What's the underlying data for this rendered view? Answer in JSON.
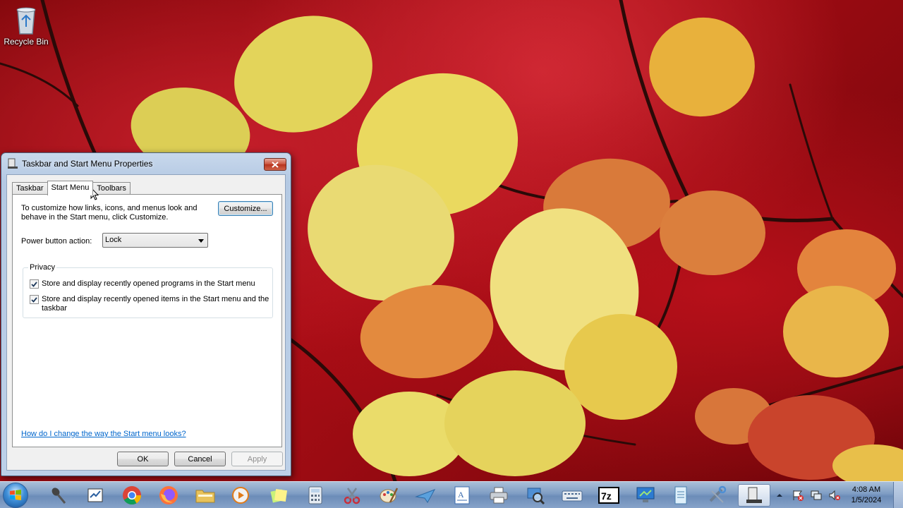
{
  "desktop": {
    "icons": [
      {
        "label": "Recycle Bin",
        "icon": "recycle-bin-icon"
      }
    ]
  },
  "dialog": {
    "title": "Taskbar and Start Menu Properties",
    "tabs": [
      {
        "label": "Taskbar",
        "active": false
      },
      {
        "label": "Start Menu",
        "active": true
      },
      {
        "label": "Toolbars",
        "active": false
      }
    ],
    "start_menu": {
      "description": "To customize how links, icons, and menus look and behave in the Start menu, click Customize.",
      "customize_label": "Customize...",
      "power_button_label": "Power button action:",
      "power_button_value": "Lock",
      "privacy": {
        "title": "Privacy",
        "options": [
          {
            "label": "Store and display recently opened programs in the Start menu",
            "checked": true
          },
          {
            "label": "Store and display recently opened items in the Start menu and the taskbar",
            "checked": true
          }
        ]
      },
      "help_link": "How do I change the way the Start menu looks?"
    },
    "buttons": {
      "ok": "OK",
      "cancel": "Cancel",
      "apply": "Apply"
    }
  },
  "taskbar": {
    "pinned": [
      "microphone-icon",
      "notepad-icon",
      "chrome-icon",
      "firefox-icon",
      "folder-icon",
      "media-player-icon",
      "sticky-notes-icon",
      "calculator-icon",
      "snipping-tool-icon",
      "paint-icon",
      "paper-plane-icon",
      "wordpad-icon",
      "printer-icon",
      "magnifier-icon",
      "keyboard-icon",
      "7zip-icon",
      "remote-desktop-icon",
      "notepad-file-icon",
      "settings-tool-icon",
      "taskbar-properties-icon"
    ],
    "active_item": "taskbar-properties-icon",
    "tray_icons": [
      "show-hidden-icons-icon",
      "action-center-icon",
      "network-icon",
      "volume-icon"
    ],
    "clock": {
      "time": "4:08 AM",
      "date": "1/5/2024"
    }
  },
  "colors": {
    "accent": "#3c7fb1",
    "link": "#0066cc",
    "close_red": "#c9503a"
  }
}
